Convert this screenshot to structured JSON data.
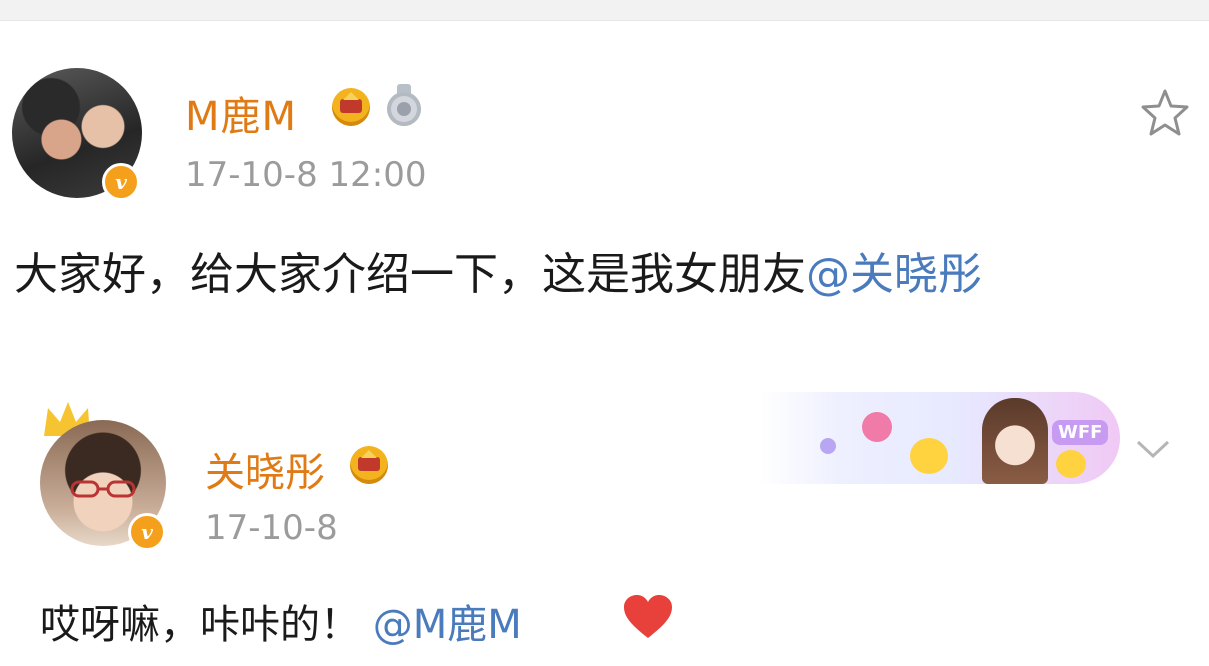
{
  "post1": {
    "username": "M鹿M",
    "time": "17-10-8 12:00",
    "text": "大家好，给大家介绍一下，这是我女朋友",
    "mention": "@关晓彤",
    "badges": [
      "crown-icon",
      "medal-icon",
      "verified-v-icon"
    ],
    "action_icon": "star-icon"
  },
  "post2": {
    "username": "关晓彤",
    "time": "17-10-8",
    "text": "哎呀嘛，咔咔的！",
    "mention": "@M鹿M",
    "emoji": "heart-icon",
    "banner_label": "WFF",
    "badges": [
      "crown-icon",
      "verified-v-icon"
    ],
    "action_icon": "chevron-down-icon"
  },
  "colors": {
    "username": "#e07a14",
    "mention": "#4a7bbd",
    "time": "#9b9b9b",
    "verified": "#f4a01c",
    "heart": "#e8403a"
  }
}
